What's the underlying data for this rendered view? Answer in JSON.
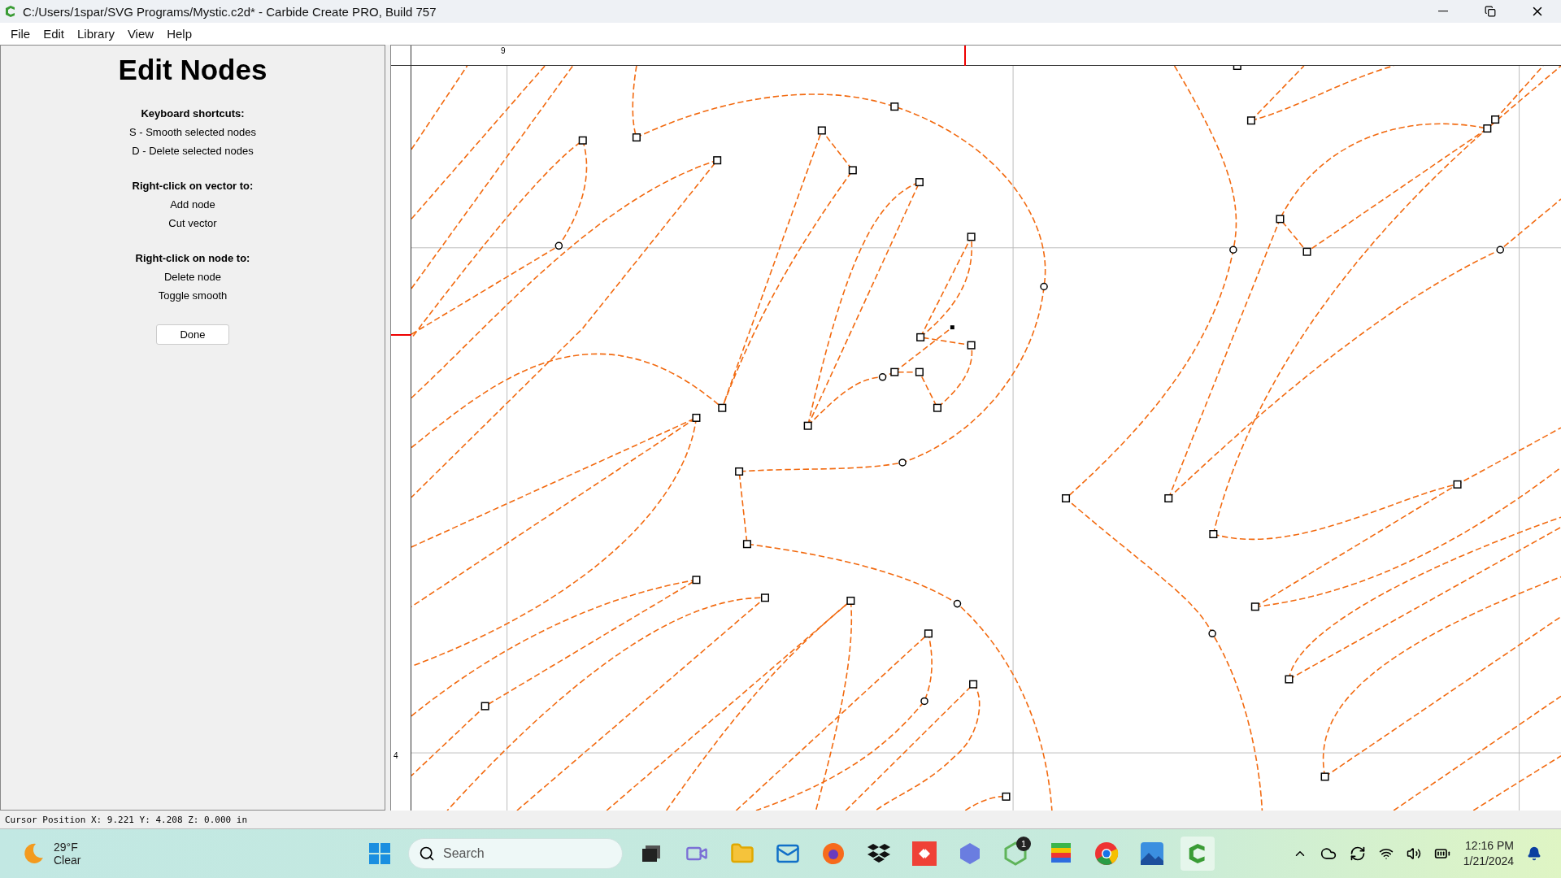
{
  "window": {
    "title": "C:/Users/1spar/SVG Programs/Mystic.c2d* - Carbide Create PRO, Build 757"
  },
  "menu": [
    "File",
    "Edit",
    "Library",
    "View",
    "Help"
  ],
  "panel": {
    "title": "Edit Nodes",
    "sections": [
      {
        "heading": "Keyboard shortcuts:",
        "items": [
          "S - Smooth selected nodes",
          "D - Delete selected nodes"
        ]
      },
      {
        "heading": "Right-click on vector to:",
        "items": [
          "Add node",
          "Cut vector"
        ]
      },
      {
        "heading": "Right-click on node to:",
        "items": [
          "Delete node",
          "Toggle smooth"
        ]
      }
    ],
    "button": "Done"
  },
  "rulers": {
    "top_label": "9",
    "left_label": "4"
  },
  "status_bar": "Cursor Position X: 9.221 Y: 4.208 Z: 0.000 in",
  "taskbar": {
    "temperature": "29°F",
    "condition": "Clear",
    "search_placeholder": "Search",
    "badge": "1",
    "time": "12:16 PM",
    "date": "1/21/2024"
  }
}
